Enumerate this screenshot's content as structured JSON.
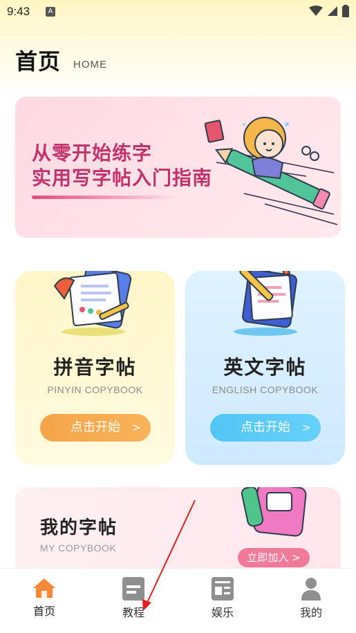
{
  "status": {
    "time": "9:43",
    "notif_letter": "A"
  },
  "header": {
    "title": "首页",
    "subtitle": "HOME"
  },
  "banner": {
    "line1": "从零开始练字",
    "line2": "实用写字帖入门指南"
  },
  "cards": [
    {
      "title": "拼音字帖",
      "subtitle": "PINYIN COPYBOOK",
      "button": "点击开始",
      "arrow": ">",
      "accent": "#f6a548"
    },
    {
      "title": "英文字帖",
      "subtitle": "ENGLISH COPYBOOK",
      "button": "点击开始",
      "arrow": ">",
      "accent": "#53c6f5"
    }
  ],
  "my_copybook": {
    "title": "我的字帖",
    "subtitle": "MY COPYBOOK",
    "button": "立即加入 >"
  },
  "tabs": [
    {
      "label": "首页",
      "icon": "home-icon",
      "active": true,
      "color": "#f7893b"
    },
    {
      "label": "教程",
      "icon": "tutorial-icon",
      "active": false,
      "color": "#8f8f8f"
    },
    {
      "label": "娱乐",
      "icon": "news-icon",
      "active": false,
      "color": "#8f8f8f"
    },
    {
      "label": "我的",
      "icon": "profile-icon",
      "active": false,
      "color": "#8f8f8f"
    }
  ],
  "colors": {
    "brand_pink": "#c4326b",
    "annotation_red": "#e02020"
  }
}
